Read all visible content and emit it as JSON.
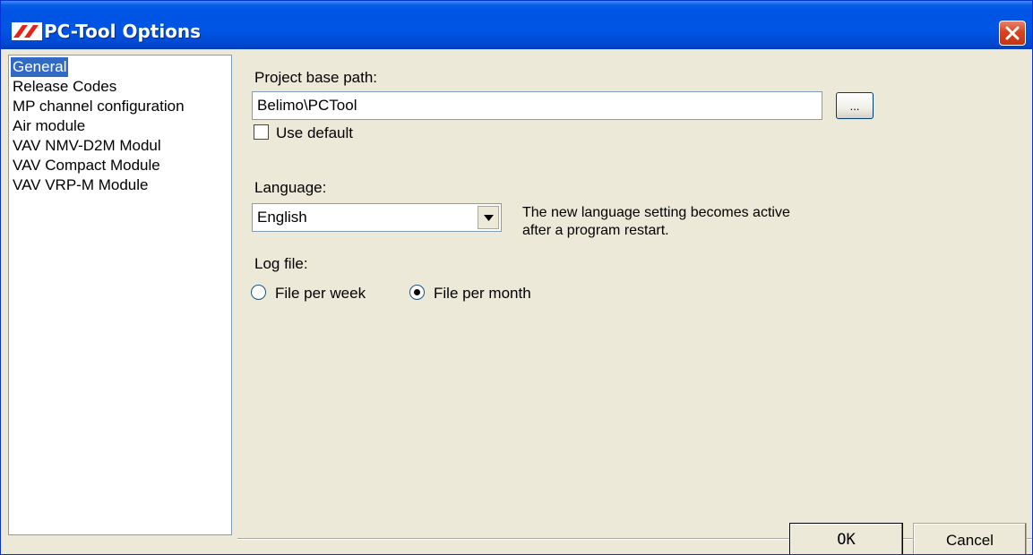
{
  "window": {
    "title": "PC-Tool Options",
    "app_icon": "belimo-logo-icon",
    "close_icon": "close-icon"
  },
  "nav": {
    "items": [
      {
        "label": "General",
        "selected": true
      },
      {
        "label": "Release Codes"
      },
      {
        "label": "MP channel configuration"
      },
      {
        "label": "Air module"
      },
      {
        "label": "VAV NMV-D2M Modul"
      },
      {
        "label": "VAV Compact Module"
      },
      {
        "label": "VAV VRP-M Module"
      }
    ]
  },
  "general": {
    "project_path_label": "Project base path:",
    "project_path_value": "Belimo\\PCTool",
    "browse_label": "...",
    "use_default_label": "Use default",
    "use_default_checked": false,
    "language_label": "Language:",
    "language_value": "English",
    "language_note_line1": "The new language setting becomes active",
    "language_note_line2": "after a program restart.",
    "logfile_label": "Log file:",
    "logfile_week_label": "File per week",
    "logfile_month_label": "File per month",
    "logfile_selected": "File per month"
  },
  "footer": {
    "ok_label": "OK",
    "cancel_label": "Cancel"
  },
  "colors": {
    "titlebar": "#0054E3",
    "selection": "#316AC5",
    "dialog_bg": "#ECE9D8",
    "close_button": "#D9431E"
  }
}
